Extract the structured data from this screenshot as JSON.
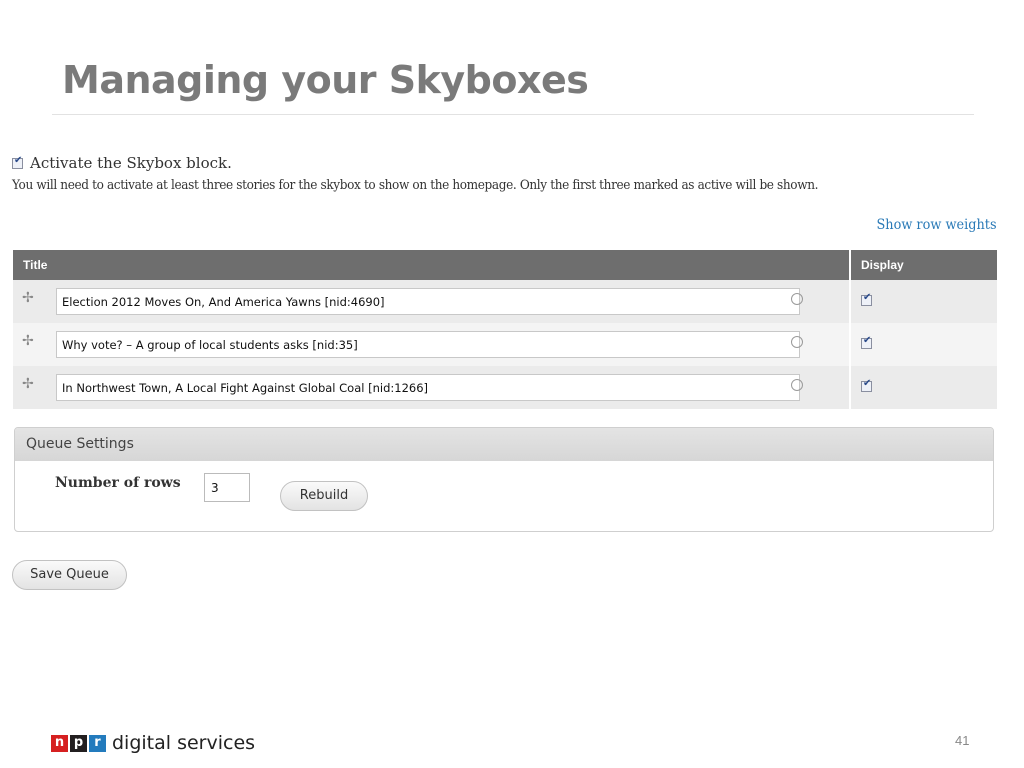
{
  "slide": {
    "title": "Managing your Skyboxes",
    "page_number": "41"
  },
  "skybox": {
    "activate_label": "Activate the Skybox block.",
    "activate_checked": true,
    "help_text": "You will need to activate at least three stories for the skybox to show on the homepage. Only the first three marked as active will be shown.",
    "show_row_weights": "Show row weights"
  },
  "table": {
    "headers": {
      "title": "Title",
      "display": "Display"
    },
    "rows": [
      {
        "title": "Election 2012 Moves On, And America Yawns [nid:4690]",
        "display": true
      },
      {
        "title": "Why vote? – A group of local students asks [nid:35]",
        "display": true
      },
      {
        "title": "In Northwest Town, A Local Fight Against Global Coal [nid:1266]",
        "display": true
      }
    ]
  },
  "queue_settings": {
    "heading": "Queue Settings",
    "rows_label": "Number of rows",
    "rows_value": "3",
    "rebuild_label": "Rebuild"
  },
  "save_label": "Save Queue",
  "footer": {
    "logo_letters": [
      "n",
      "p",
      "r"
    ],
    "brand_text": "digital services",
    "colors": {
      "n": "#d62021",
      "p": "#231f20",
      "r": "#237bbd"
    }
  }
}
